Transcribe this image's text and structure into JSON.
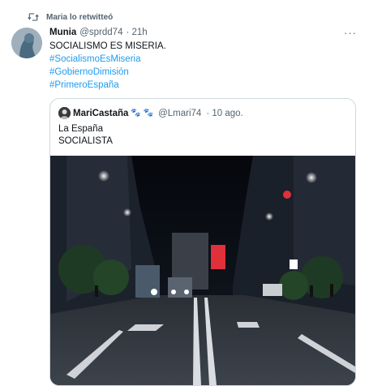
{
  "retweet": {
    "label": "Maria lo retwitteó",
    "icon": "retweet-icon"
  },
  "tweet": {
    "name": "Munia",
    "handle": "@sprdd74",
    "time": "· 21h",
    "text": "SOCIALISMO ES MISERIA.",
    "hashtags": [
      "#SocialismoEsMiseria",
      "#GobiernoDimisión",
      "#PrimeroEspaña"
    ],
    "more": "···"
  },
  "quote": {
    "name": "MariCastaña",
    "emoji": "🐾 🐾",
    "handle": "@Lmari74",
    "time": "· 10 ago.",
    "lines": [
      "La España",
      "SOCIALISTA"
    ],
    "image": {
      "description": "night-street-photo"
    }
  },
  "colors": {
    "link": "#1d9bf0",
    "muted": "#536471",
    "border": "#cfd9de"
  }
}
